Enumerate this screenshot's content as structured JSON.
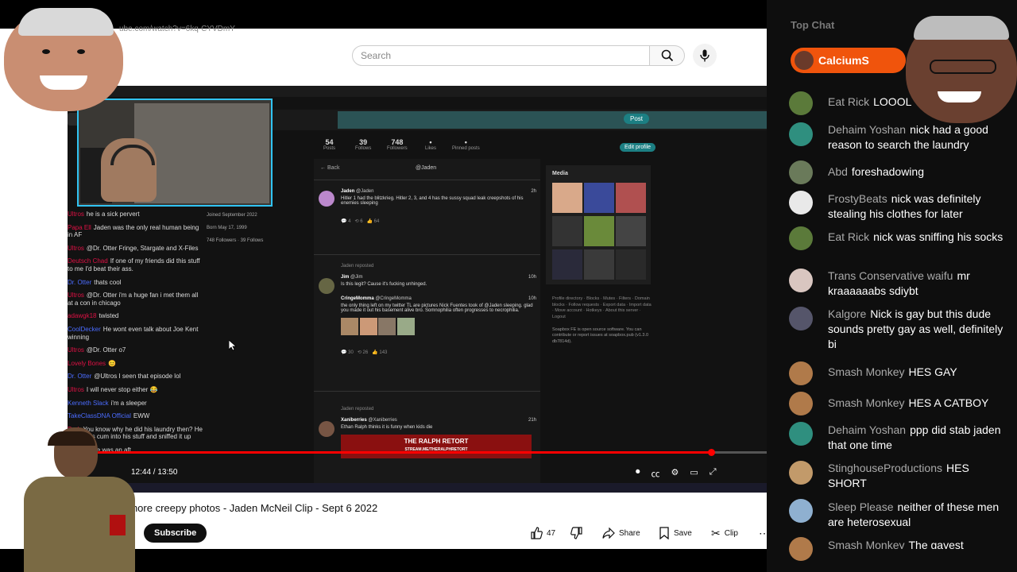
{
  "browser": {
    "url_fragment": "ube.com/watch?v=6kq-CYVDmY",
    "search_placeholder": "Search"
  },
  "video_screen": {
    "post_button": "Post",
    "edit_profile": "Edit profile",
    "stats": [
      {
        "value": "54",
        "label": "Posts"
      },
      {
        "value": "39",
        "label": "Follows"
      },
      {
        "value": "748",
        "label": "Followers"
      },
      {
        "value": "•",
        "label": "Likes"
      },
      {
        "value": "•",
        "label": "Pinned posts"
      }
    ],
    "back": "← Back",
    "handle": "@Jaden",
    "profile_meta": [
      "Joined September 2022",
      "Born May 17, 1999",
      "748 Followers · 39 Follows"
    ],
    "chat": [
      {
        "user": "Ultros",
        "text": "he is a sick pervert"
      },
      {
        "user": "Papa Ell",
        "text": "Jaden was the only real human being in AF"
      },
      {
        "user": "Ultros",
        "text": "@Dr. Otter Fringe, Stargate and X-Files"
      },
      {
        "user": "Deutsch Chad",
        "text": "If one of my friends did this stuff to me I'd beat their ass."
      },
      {
        "user": "Dr. Otter",
        "text": "thats cool"
      },
      {
        "user": "Ultros",
        "text": "@Dr. Otter i'm a huge fan i met them all at a con in chicago"
      },
      {
        "user": "adawgk18",
        "text": "twisted"
      },
      {
        "user": "CoolDecker",
        "text": "He wont even talk about Joe Kent winning"
      },
      {
        "user": "Ultros",
        "text": "@Dr. Otter o7"
      },
      {
        "user": "Lovely Bones",
        "text": "😊"
      },
      {
        "user": "Dr. Otter",
        "text": "@Ultros I seen that episode lol"
      },
      {
        "user": "Ultros",
        "text": "I will never stop either 😂"
      },
      {
        "user": "Kenneth Slack",
        "text": "i'm a sleeper"
      },
      {
        "user": "TakeClassDNA Official",
        "text": "EWW"
      },
      {
        "user": "Pork",
        "text": "You know why he did his laundry then? He buried his cum into his stuff and sniffed it up"
      },
      {
        "user": "",
        "text": "Otter there was an aft..."
      }
    ],
    "tweets": [
      {
        "name": "Jaden",
        "handle": "@Jaden",
        "time": "2h",
        "body": "Hitler 1 had the blitzkrieg. Hitler 2, 3, and 4 has the sussy squad leak creepshots of his enemies sleeping",
        "reply": "4",
        "rt": "6",
        "like": "64"
      },
      {
        "repost": "Jaden reposted",
        "name": "Jim",
        "handle": "@Jim",
        "time": "10h",
        "body": "Is this legit? Cause it's fucking unhinged.",
        "quote_name": "CringeMomma",
        "quote_handle": "@CringeMomma",
        "quote_time": "10h",
        "quote_body": "the only thing left on my twitter TL are pictures Nick Fuentes took of @Jaden sleeping. glad you made it out his basement alive bro. Somnophilia often progresses to necrophilia.",
        "reply": "30",
        "rt": "26",
        "like": "143"
      },
      {
        "repost": "Jaden reposted",
        "name": "Xaniberries",
        "handle": "@Xaniberries",
        "time": "21h",
        "body": "Ethan Ralph thinks it is funny when kids die",
        "banner": "THE RALPH RETORT",
        "banner_sub": "STREAM.ME/THERALPHRETORT"
      }
    ],
    "media_label": "Media",
    "sidebar_links": "Profile directory · Blocks · Mutes · Filters · Domain blocks · Follow requests · Export data · Import data · Move account · Hotkeys · About this server · Logout",
    "software_note": "Soapbox FE is open source software. You can contribute or report issues at soapbox.pub (v1.3.0 db7814d).",
    "time": "12:44 / 13:50"
  },
  "youtube": {
    "title": "es more creepy photos - Jaden McNeil Clip - Sept 6 2022",
    "subscribe": "Subscribe",
    "likes": "47",
    "share": "Share",
    "save": "Save",
    "clip": "Clip"
  },
  "live_chat": {
    "top_label": "Top Chat",
    "pinned_user": "CalciumS",
    "messages": [
      {
        "user": "Eat Rick",
        "text": "LOOOL",
        "color": "#5b7a3a"
      },
      {
        "user": "Dehaim Yoshan",
        "text": "nick had a good reason to search the laundry",
        "color": "#2f8f7f"
      },
      {
        "user": "Abd",
        "text": "foreshadowing",
        "color": "#6a7a5a"
      },
      {
        "user": "FrostyBeats",
        "text": "nick was definitely stealing his clothes for later",
        "color": "#e9e9e9"
      },
      {
        "user": "Eat Rick",
        "text": "nick was sniffing his socks",
        "color": "#5b7a3a"
      },
      {
        "user": "Trans Conservative waifu",
        "text": "mr kraaaaaabs sdiybt",
        "color": "#d9c6c0"
      },
      {
        "user": "Kalgore",
        "text": "Nick is gay but this dude sounds pretty gay as well, definitely bi",
        "color": "#55556a"
      },
      {
        "user": "Smash Monkey",
        "text": "HES GAY",
        "color": "#b07a4a"
      },
      {
        "user": "Smash Monkey",
        "text": "HES A CATBOY",
        "color": "#b07a4a"
      },
      {
        "user": "Dehaim Yoshan",
        "text": "ppp did stab jaden that one time",
        "color": "#2f8f7f"
      },
      {
        "user": "StinghouseProductions",
        "text": "HES SHORT",
        "color": "#c29a6a"
      },
      {
        "user": "Sleep Please",
        "text": "neither of these men are heterosexual",
        "color": "#8fb0d0"
      },
      {
        "user": "Smash Monkey",
        "text": "The gayest",
        "color": "#b07a4a"
      }
    ]
  }
}
